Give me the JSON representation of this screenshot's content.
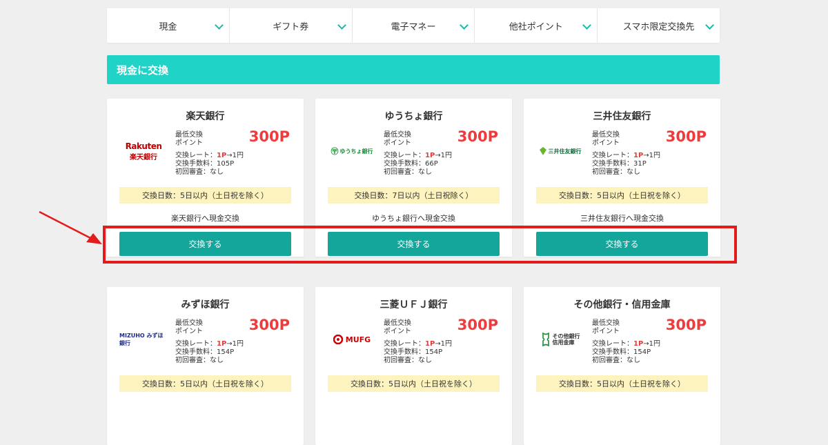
{
  "tabs": [
    {
      "label": "現金"
    },
    {
      "label": "ギフト券"
    },
    {
      "label": "電子マネー"
    },
    {
      "label": "他社ポイント"
    },
    {
      "label": "スマホ限定交換先"
    }
  ],
  "section": {
    "title": "現金に交換"
  },
  "common": {
    "min_label_1": "最低交換",
    "min_label_2": "ポイント",
    "rate_label": "交換レート：",
    "rate_p": "1P",
    "rate_to": "→1円",
    "review": "初回審査：なし",
    "button_label": "交換する"
  },
  "cards": [
    {
      "title": "楽天銀行",
      "price": "300P",
      "fee": "交換手数料：105P",
      "days": "交換日数：5日以内（土日祝を除く）",
      "desc": "楽天銀行へ現金交換",
      "logo_text_1": "Rakuten",
      "logo_text_2": "楽天銀行",
      "logo_icon": "rakuten-bank-logo"
    },
    {
      "title": "ゆうちょ銀行",
      "price": "300P",
      "fee": "交換手数料：66P",
      "days": "交換日数：7日以内（土日祝除く）",
      "desc": "ゆうちょ銀行へ現金交換",
      "logo_text_1": "ゆうちょ銀行",
      "logo_icon": "yucho-bank-logo"
    },
    {
      "title": "三井住友銀行",
      "price": "300P",
      "fee": "交換手数料：31P",
      "days": "交換日数：5日以内（土日祝を除く）",
      "desc": "三井住友銀行へ現金交換",
      "logo_text_1": "三井住友銀行",
      "logo_icon": "smbc-logo"
    },
    {
      "title": "みずほ銀行",
      "price": "300P",
      "fee": "交換手数料：154P",
      "days": "交換日数：5日以内（土日祝を除く）",
      "logo_text_1": "MIZUHO みずほ銀行",
      "logo_icon": "mizuho-logo"
    },
    {
      "title": "三菱ＵＦＪ銀行",
      "price": "300P",
      "fee": "交換手数料：154P",
      "days": "交換日数：5日以内（土日祝を除く）",
      "logo_text_1": "MUFG",
      "logo_icon": "mufg-logo"
    },
    {
      "title": "その他銀行・信用金庫",
      "price": "300P",
      "fee": "交換手数料：154P",
      "days": "交換日数：5日以内（土日祝を除く）",
      "logo_text_1": "その他銀行",
      "logo_text_2": "信用金庫",
      "logo_icon": "other-bank-logo"
    }
  ],
  "colors": {
    "accent": "#20d3c7",
    "button": "#14a69b",
    "price": "#ef3b3b",
    "highlight": "#e41b1b",
    "days_bg": "#fdf3bf"
  }
}
